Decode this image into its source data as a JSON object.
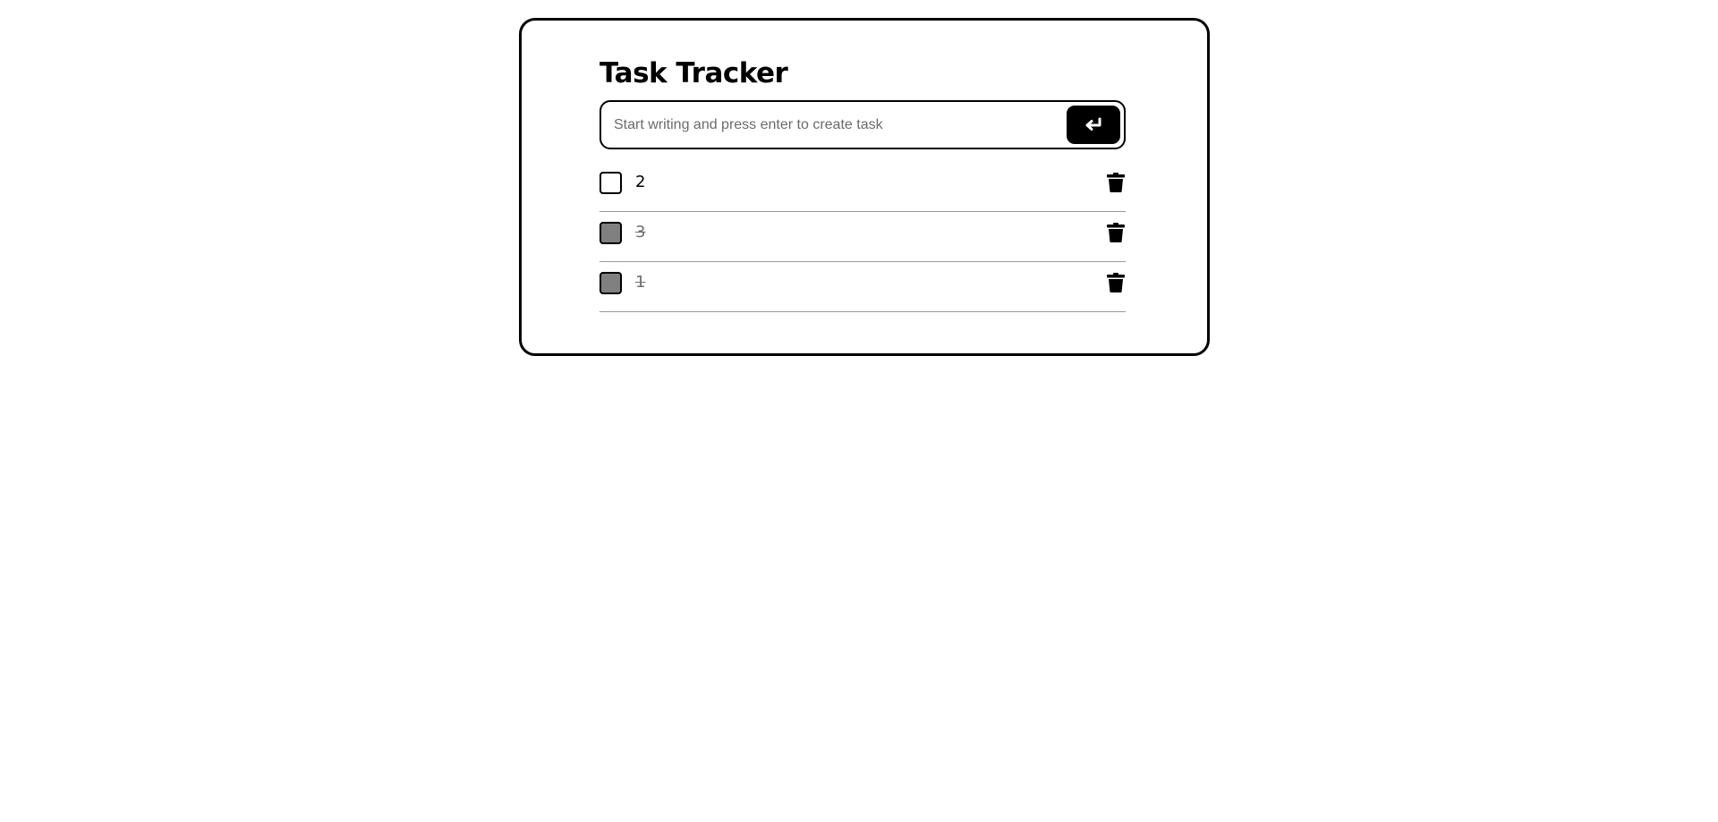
{
  "app": {
    "title": "Task Tracker"
  },
  "new_task": {
    "value": "",
    "placeholder": "Start writing and press enter to create task",
    "submit_icon": "enter-icon"
  },
  "tasks": [
    {
      "text": "2",
      "completed": false,
      "delete_icon": "trash-icon"
    },
    {
      "text": "3",
      "completed": true,
      "delete_icon": "trash-icon"
    },
    {
      "text": "1",
      "completed": true,
      "delete_icon": "trash-icon"
    }
  ],
  "colors": {
    "accent": "#000000",
    "completed_checkbox": "#808080",
    "completed_text": "#6e6e6e",
    "divider": "#9a9a9a"
  }
}
